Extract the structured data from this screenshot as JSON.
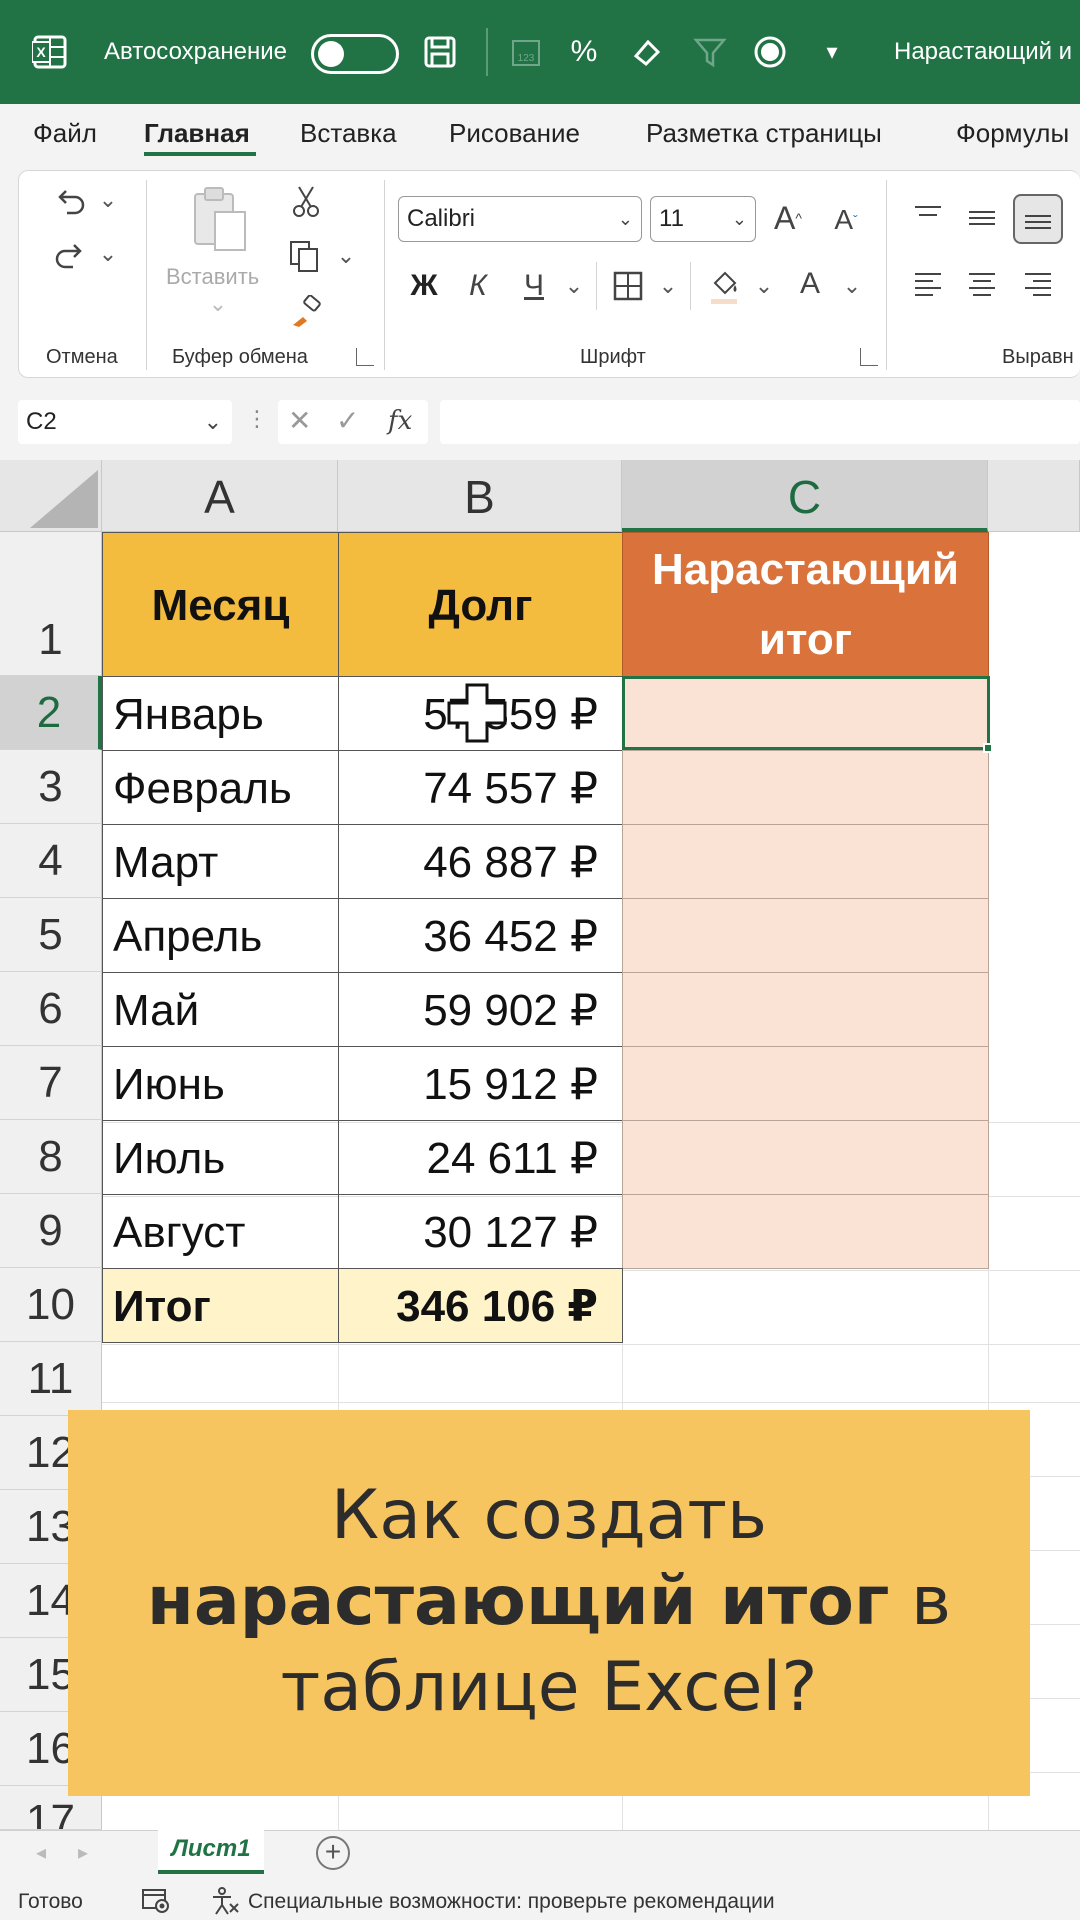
{
  "titlebar": {
    "autosave_label": "Автосохранение",
    "document_title": "Нарастающий и"
  },
  "menu": {
    "tabs": [
      "Файл",
      "Главная",
      "Вставка",
      "Рисование",
      "Разметка страницы",
      "Формулы"
    ],
    "active": "Главная"
  },
  "ribbon": {
    "groups": {
      "undo": "Отмена",
      "clipboard": "Буфер обмена",
      "font": "Шрифт",
      "alignment": "Выравн"
    },
    "paste_label": "Вставить",
    "font_name": "Calibri",
    "font_size": "11",
    "bold": "Ж",
    "italic": "К",
    "underline": "Ч",
    "grow_font": "A",
    "shrink_font": "A",
    "font_color": "A"
  },
  "formula_bar": {
    "name_box": "C2",
    "fx": "fx",
    "formula": ""
  },
  "sheet": {
    "columns": [
      "A",
      "B",
      "C"
    ],
    "selected_column": "C",
    "selected_row": "2",
    "row_numbers": [
      "1",
      "2",
      "3",
      "4",
      "5",
      "6",
      "7",
      "8",
      "9",
      "10",
      "11",
      "12",
      "13",
      "14",
      "15",
      "16",
      "17"
    ],
    "headers": {
      "month": "Месяц",
      "debt": "Долг",
      "running_total_line1": "Нарастающий",
      "running_total_line2": "итог"
    },
    "rows": [
      {
        "month": "Январь",
        "debt": "57 559 ₽"
      },
      {
        "month": "Февраль",
        "debt": "74 557 ₽"
      },
      {
        "month": "Март",
        "debt": "46 887 ₽"
      },
      {
        "month": "Апрель",
        "debt": "36 452 ₽"
      },
      {
        "month": "Май",
        "debt": "59 902 ₽"
      },
      {
        "month": "Июнь",
        "debt": "15 912 ₽"
      },
      {
        "month": "Июль",
        "debt": "24 611 ₽"
      },
      {
        "month": "Август",
        "debt": "30 127 ₽"
      }
    ],
    "total": {
      "label": "Итог",
      "value": "346 106 ₽"
    },
    "colors": {
      "header_fill": "#f4bc3f",
      "running_header_fill": "#d9733b",
      "running_cell_fill": "#fae2d4",
      "total_fill": "#fff4c9",
      "excel_green": "#217346"
    }
  },
  "banner": {
    "line1": "Как создать",
    "line2_bold": "нарастающий итог",
    "line2_rest": " в",
    "line3": "таблице Excel?",
    "color": "#f7c55f"
  },
  "sheet_tabs": {
    "active": "Лист1",
    "add_icon": "+"
  },
  "status": {
    "ready": "Готово",
    "accessibility": "Специальные возможности: проверьте рекомендации"
  }
}
